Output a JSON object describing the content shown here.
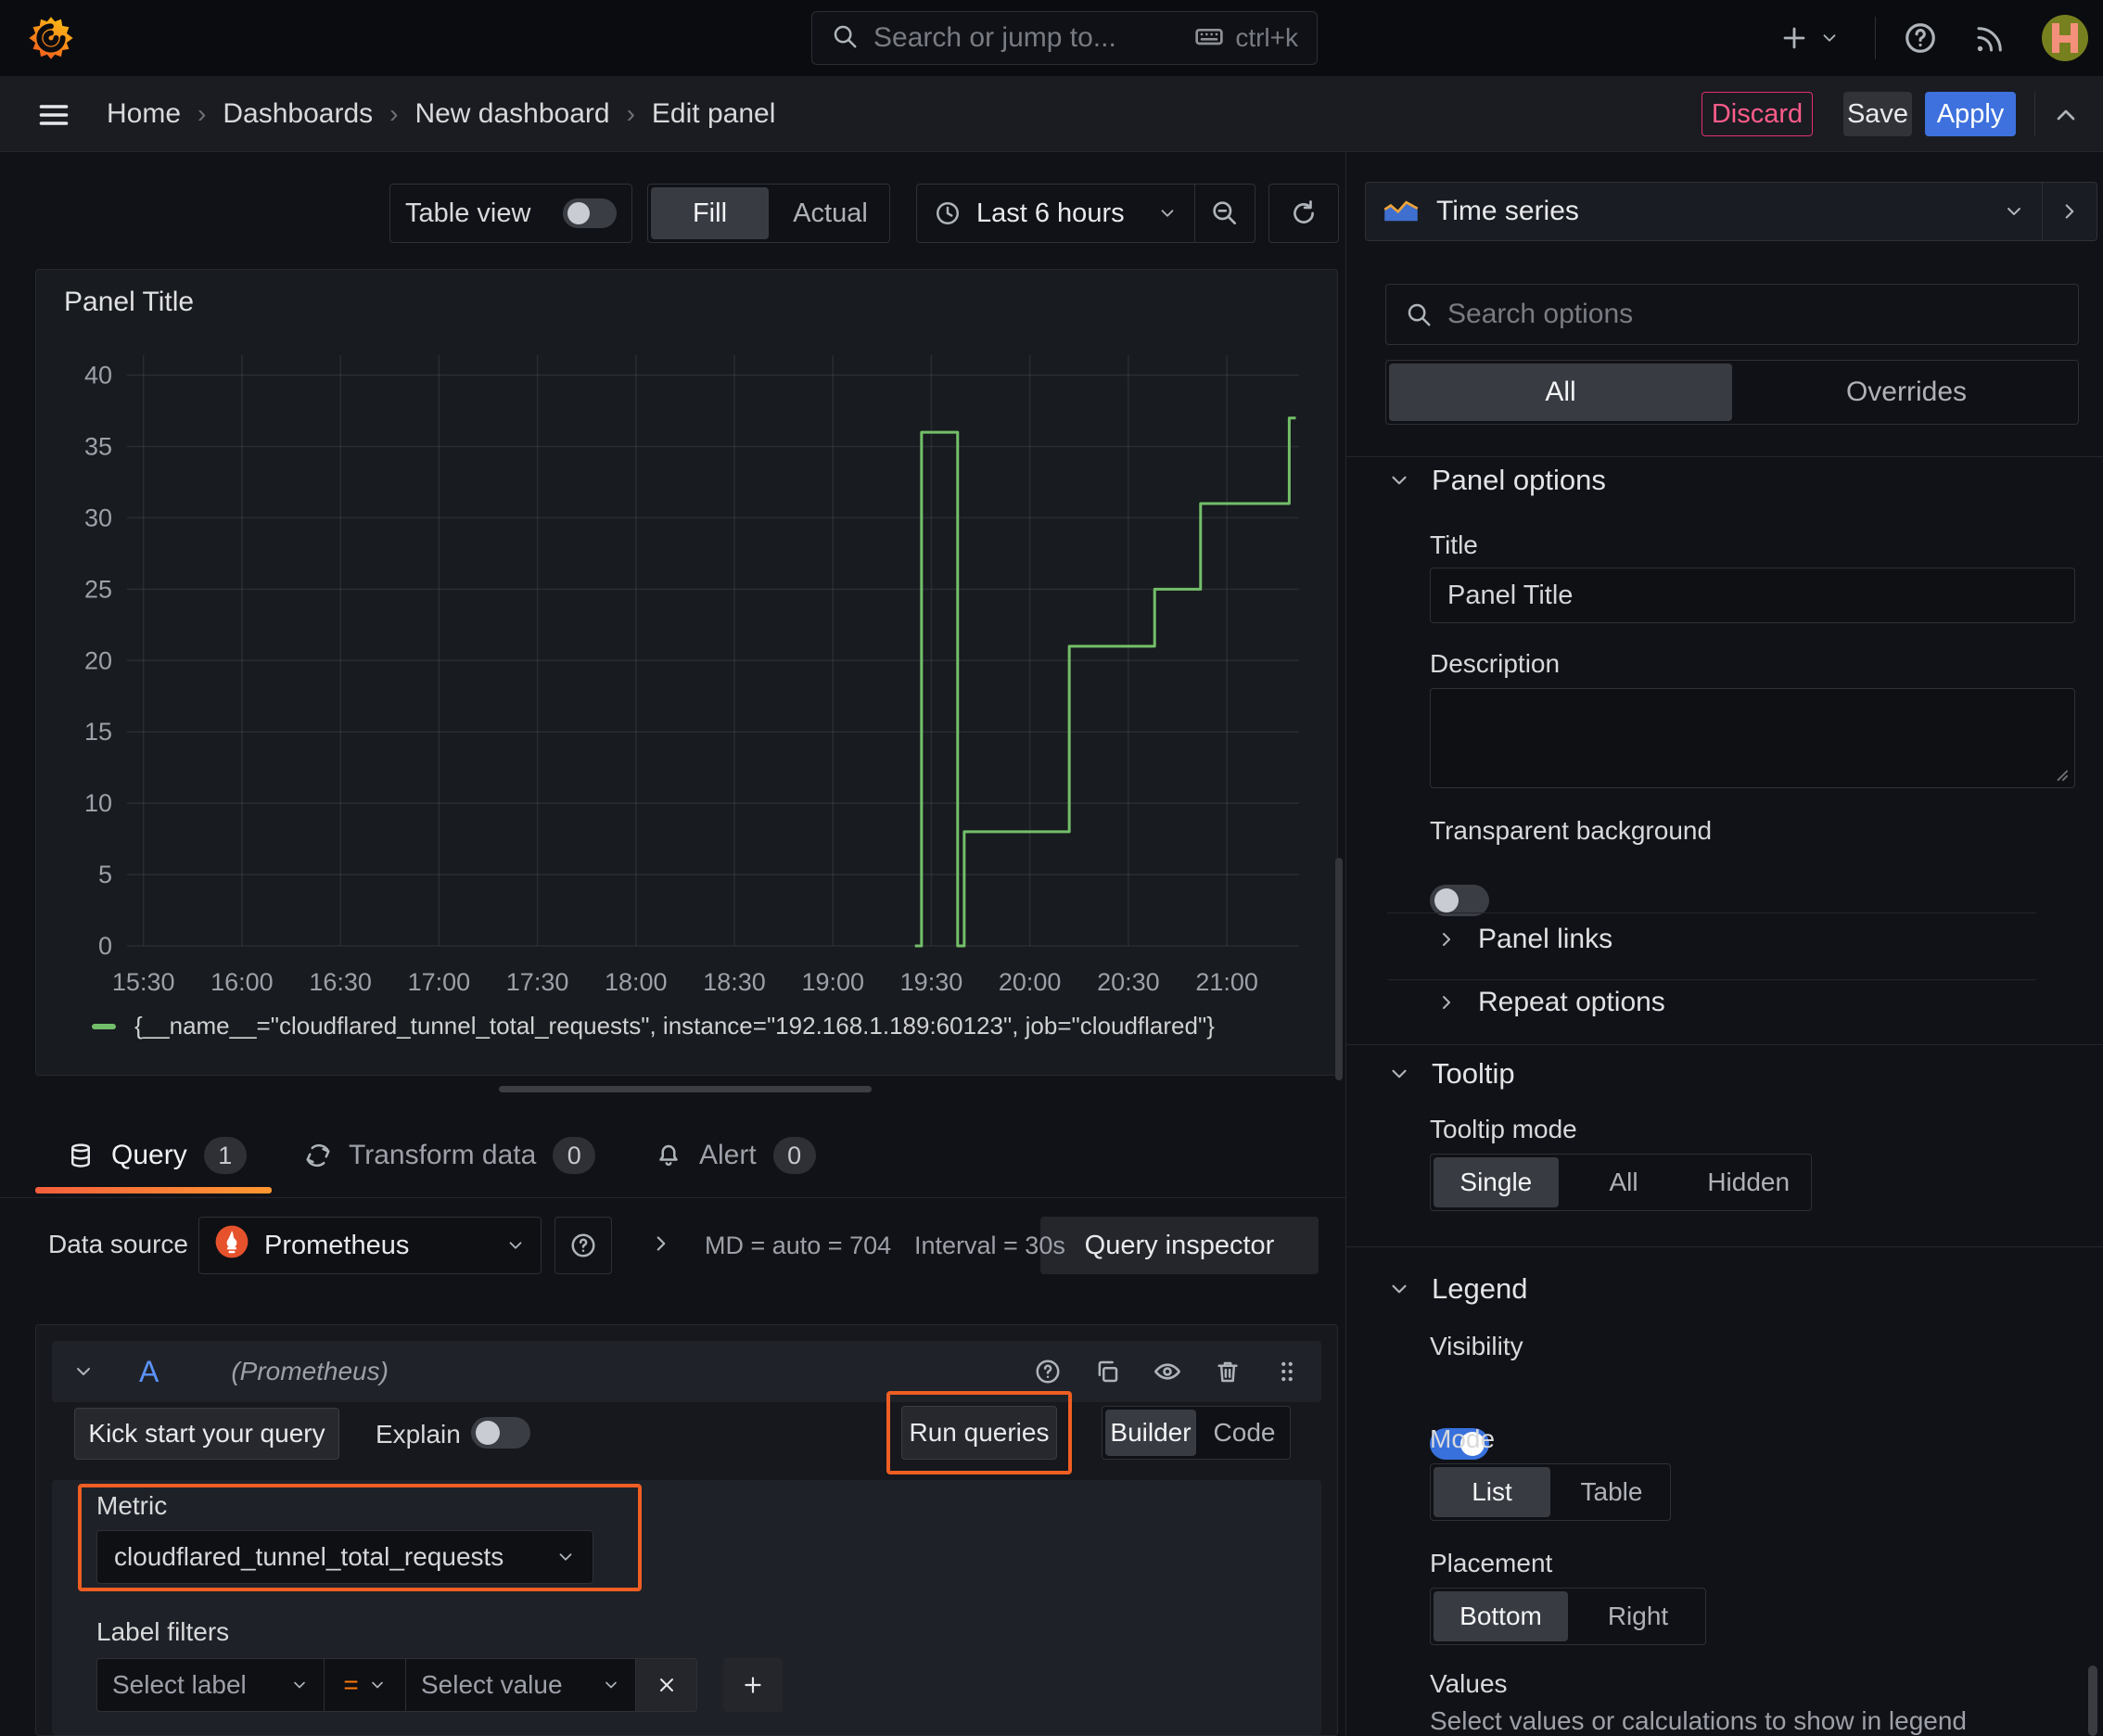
{
  "topbar": {
    "search_placeholder": "Search or jump to...",
    "search_shortcut": "ctrl+k"
  },
  "breadcrumb": {
    "items": [
      "Home",
      "Dashboards",
      "New dashboard",
      "Edit panel"
    ]
  },
  "actions": {
    "discard": "Discard",
    "save": "Save",
    "apply": "Apply"
  },
  "toolbar": {
    "table_view": "Table view",
    "fill": "Fill",
    "actual": "Actual",
    "time_range": "Last 6 hours"
  },
  "panel": {
    "title": "Panel Title"
  },
  "chart_data": {
    "type": "line",
    "render": "step-after",
    "title": "Panel Title",
    "x_ticks": [
      "15:30",
      "16:00",
      "16:30",
      "17:00",
      "17:30",
      "18:00",
      "18:30",
      "19:00",
      "19:30",
      "20:00",
      "20:30",
      "21:00"
    ],
    "x_domain_minutes": [
      925,
      1282
    ],
    "y_ticks": [
      0,
      5,
      10,
      15,
      20,
      25,
      30,
      35,
      40
    ],
    "ylim": [
      0,
      41.4
    ],
    "grid": true,
    "legend_position": "bottom",
    "series": [
      {
        "name": "{__name__=\"cloudflared_tunnel_total_requests\", instance=\"192.168.1.189:60123\", job=\"cloudflared\"}",
        "color": "#73bf69",
        "points": [
          {
            "t": "19:25",
            "v": 0
          },
          {
            "t": "19:27",
            "v": 36
          },
          {
            "t": "19:38",
            "v": 0
          },
          {
            "t": "19:40",
            "v": 8
          },
          {
            "t": "20:12",
            "v": 21
          },
          {
            "t": "20:38",
            "v": 25
          },
          {
            "t": "20:52",
            "v": 31
          },
          {
            "t": "21:19",
            "v": 37
          },
          {
            "t": "21:21",
            "v": 37
          }
        ]
      }
    ]
  },
  "tabs": {
    "query": "Query",
    "query_count": "1",
    "transform": "Transform data",
    "transform_count": "0",
    "alert": "Alert",
    "alert_count": "0"
  },
  "datasource_row": {
    "label": "Data source",
    "name": "Prometheus",
    "stats": "MD = auto = 704",
    "interval": "Interval = 30s",
    "inspector": "Query inspector"
  },
  "query": {
    "ref": "A",
    "ds_hint": "(Prometheus)",
    "kickstart": "Kick start your query",
    "explain": "Explain",
    "run": "Run queries",
    "builder": "Builder",
    "code": "Code",
    "metric_label": "Metric",
    "metric_value": "cloudflared_tunnel_total_requests",
    "filters_label": "Label filters",
    "select_label": "Select label",
    "operator": "=",
    "select_value": "Select value"
  },
  "sidebar": {
    "viz": "Time series",
    "search_placeholder": "Search options",
    "tab_all": "All",
    "tab_overrides": "Overrides",
    "panel_options": "Panel options",
    "title_label": "Title",
    "title_value": "Panel Title",
    "description_label": "Description",
    "transparent": "Transparent background",
    "panel_links": "Panel links",
    "repeat_options": "Repeat options",
    "tooltip": "Tooltip",
    "tooltip_mode": "Tooltip mode",
    "tip_single": "Single",
    "tip_all": "All",
    "tip_hidden": "Hidden",
    "legend": "Legend",
    "visibility": "Visibility",
    "mode": "Mode",
    "mode_list": "List",
    "mode_table": "Table",
    "placement": "Placement",
    "place_bottom": "Bottom",
    "place_right": "Right",
    "values_label": "Values",
    "values_help": "Select values or calculations to show in legend"
  },
  "colors": {
    "series_green": "#73bf69",
    "annotation_orange": "#ef5e23",
    "primary_blue": "#3e71dd",
    "danger_pink": "#e02f6e",
    "tab_underline_start": "#f55f3c",
    "tab_underline_end": "#ff9830"
  }
}
